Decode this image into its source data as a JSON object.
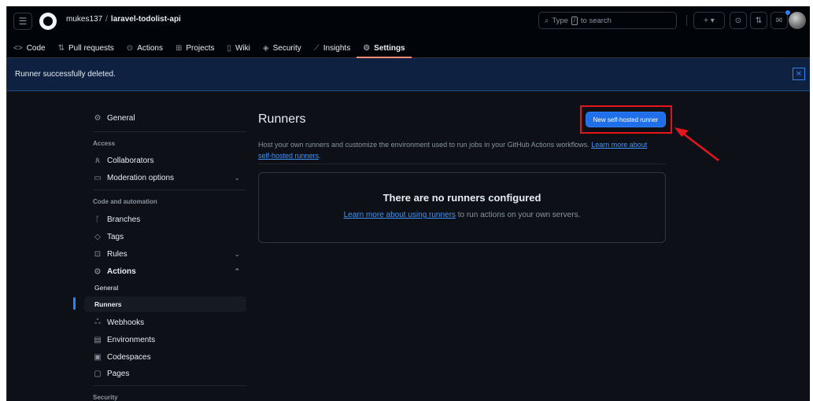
{
  "header": {
    "owner": "mukes137",
    "separator": "/",
    "repo": "laravel-todolist-api",
    "search_placeholder": "Type",
    "search_kbd": "/",
    "search_suffix": "to search",
    "plus_label": "+ ▾"
  },
  "tabs": [
    {
      "label": "Code",
      "icon": "code-icon"
    },
    {
      "label": "Pull requests",
      "icon": "pull-request-icon"
    },
    {
      "label": "Actions",
      "icon": "play-icon"
    },
    {
      "label": "Projects",
      "icon": "table-icon"
    },
    {
      "label": "Wiki",
      "icon": "book-icon"
    },
    {
      "label": "Security",
      "icon": "shield-icon"
    },
    {
      "label": "Insights",
      "icon": "graph-icon"
    },
    {
      "label": "Settings",
      "icon": "gear-icon",
      "active": true
    }
  ],
  "flash": {
    "message": "Runner successfully deleted."
  },
  "sidebar": {
    "general": "General",
    "access_heading": "Access",
    "collaborators": "Collaborators",
    "moderation": "Moderation options",
    "code_heading": "Code and automation",
    "branches": "Branches",
    "tags": "Tags",
    "rules": "Rules",
    "actions": "Actions",
    "actions_general": "General",
    "actions_runners": "Runners",
    "webhooks": "Webhooks",
    "environments": "Environments",
    "codespaces": "Codespaces",
    "pages": "Pages",
    "security_heading": "Security"
  },
  "main": {
    "title": "Runners",
    "new_runner_button": "New self-hosted runner",
    "description": "Host your own runners and customize the environment used to run jobs in your GitHub Actions workflows.",
    "description_link": "Learn more about self-hosted runners",
    "description_end": ".",
    "blank_title": "There are no runners configured",
    "blank_link": "Learn more about using runners",
    "blank_rest": " to run actions on your own servers."
  },
  "colors": {
    "background": "#0d1117",
    "accent": "#1f6feb",
    "flash": "#0e2140",
    "annotation": "#e5161b"
  }
}
